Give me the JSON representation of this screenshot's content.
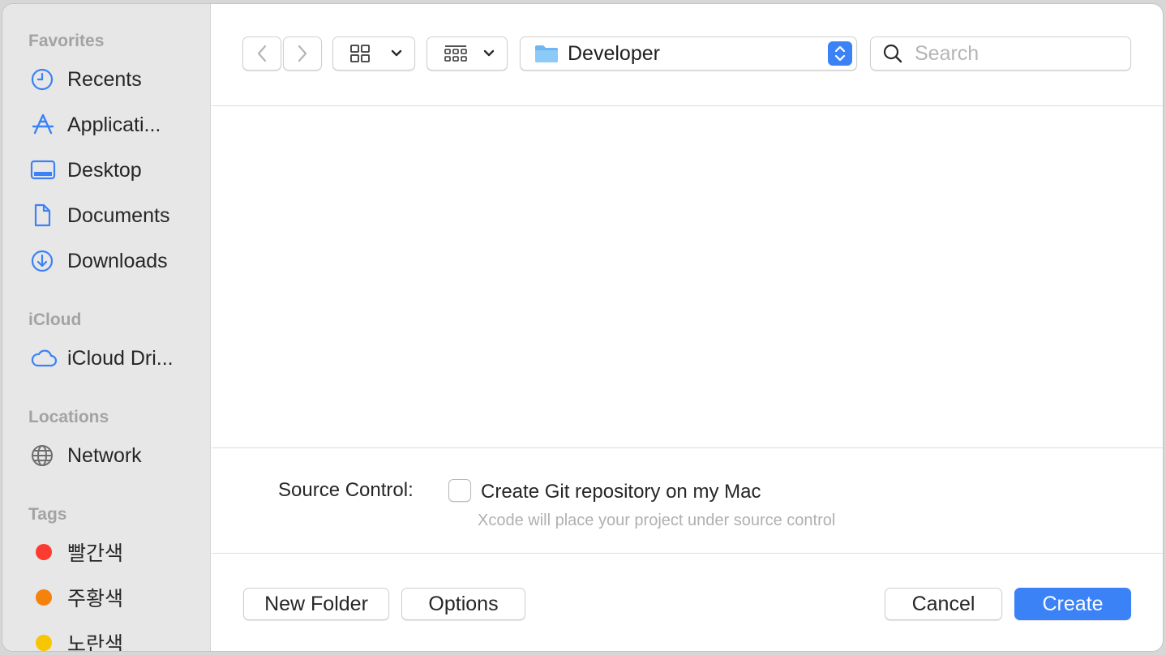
{
  "sidebar": {
    "favorites_title": "Favorites",
    "favorites": [
      {
        "label": "Recents",
        "icon": "clock-icon"
      },
      {
        "label": "Applicati...",
        "icon": "applications-icon"
      },
      {
        "label": "Desktop",
        "icon": "desktop-icon"
      },
      {
        "label": "Documents",
        "icon": "document-icon"
      },
      {
        "label": "Downloads",
        "icon": "download-icon"
      }
    ],
    "icloud_title": "iCloud",
    "icloud": [
      {
        "label": "iCloud Dri...",
        "icon": "cloud-icon"
      }
    ],
    "locations_title": "Locations",
    "locations": [
      {
        "label": "Network",
        "icon": "globe-icon"
      }
    ],
    "tags_title": "Tags",
    "tags": [
      {
        "label": "빨간색",
        "color": "#fe3b30"
      },
      {
        "label": "주황색",
        "color": "#f5820c"
      },
      {
        "label": "노란색",
        "color": "#f7c600"
      }
    ]
  },
  "toolbar": {
    "path_label": "Developer",
    "search_placeholder": "Search"
  },
  "options": {
    "source_control_label": "Source Control:",
    "git_checkbox_label": "Create Git repository on my Mac",
    "git_checked": false,
    "git_hint": "Xcode will place your project under source control"
  },
  "buttons": {
    "new_folder": "New Folder",
    "options": "Options",
    "cancel": "Cancel",
    "create": "Create"
  },
  "colors": {
    "accent": "#3b82f6",
    "sidebar_icon": "#3b82f6",
    "folder": "#6cb6f4"
  }
}
